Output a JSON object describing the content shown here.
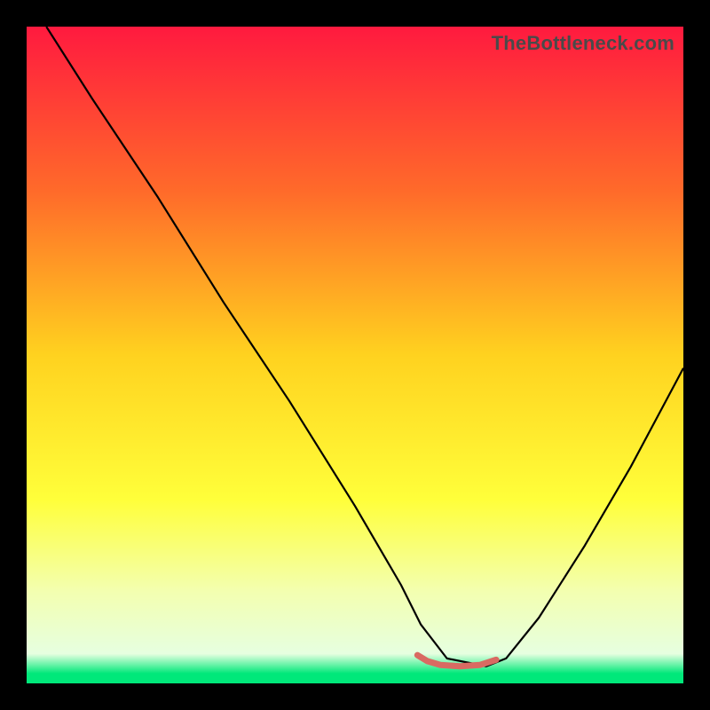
{
  "watermark": "TheBottleneck.com",
  "chart_data": {
    "type": "line",
    "title": "",
    "xlabel": "",
    "ylabel": "",
    "xlim": [
      0,
      100
    ],
    "ylim": [
      0,
      100
    ],
    "grid": false,
    "legend": false,
    "background_gradient": {
      "stops": [
        {
          "offset": 0.0,
          "color": "#ff1a3f"
        },
        {
          "offset": 0.25,
          "color": "#ff6a2a"
        },
        {
          "offset": 0.5,
          "color": "#ffd21f"
        },
        {
          "offset": 0.72,
          "color": "#ffff3a"
        },
        {
          "offset": 0.86,
          "color": "#f3ffb0"
        },
        {
          "offset": 0.955,
          "color": "#e6ffe0"
        },
        {
          "offset": 0.985,
          "color": "#00e87a"
        },
        {
          "offset": 1.0,
          "color": "#00e87a"
        }
      ]
    },
    "series": [
      {
        "name": "curve",
        "color": "#000000",
        "width": 2.2,
        "x": [
          3,
          10,
          20,
          30,
          40,
          50,
          57,
          60,
          64,
          70,
          73,
          78,
          85,
          92,
          100
        ],
        "y": [
          100,
          89,
          74,
          58,
          43,
          27,
          15,
          9,
          3.8,
          2.6,
          3.8,
          10,
          21,
          33,
          48
        ]
      },
      {
        "name": "marker-band",
        "color": "#d96a62",
        "width": 7,
        "linecap": "round",
        "x": [
          59.5,
          61,
          63,
          66,
          69,
          71.5
        ],
        "y": [
          4.3,
          3.4,
          2.8,
          2.6,
          2.8,
          3.6
        ]
      }
    ]
  }
}
